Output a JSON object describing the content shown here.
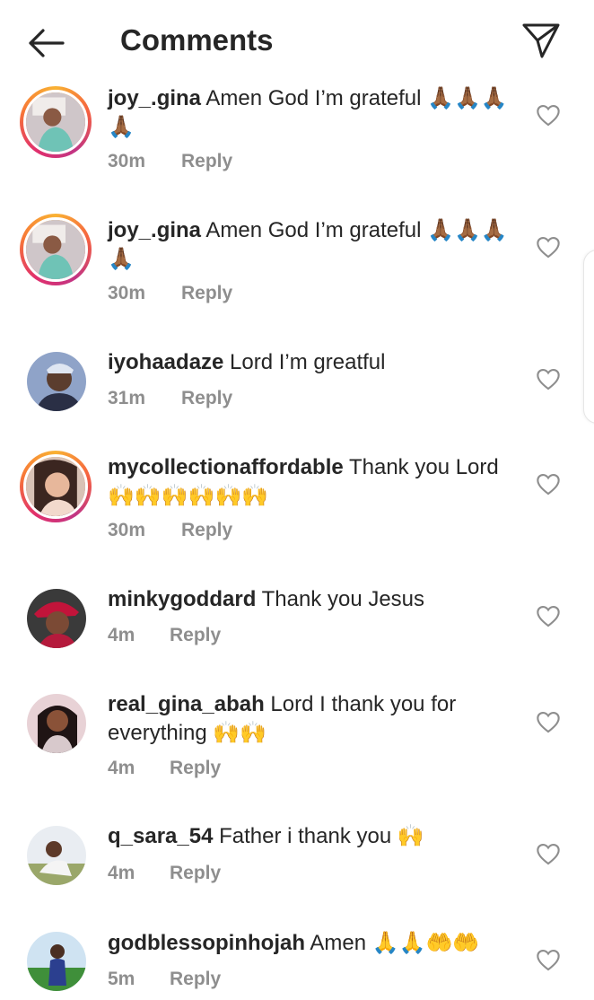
{
  "header": {
    "title": "Comments",
    "back_icon": "arrow-left-icon",
    "send_icon": "paper-plane-icon"
  },
  "reply_label": "Reply",
  "comments": [
    {
      "username": "joy_.gina",
      "text": " Amen God I’m grateful",
      "emoji": " 🙏🏾🙏🏾🙏🏾🙏🏾",
      "time": "30m",
      "avatar_style": "story"
    },
    {
      "username": "joy_.gina",
      "text": " Amen God I’m grateful",
      "emoji": " 🙏🏾🙏🏾🙏🏾🙏🏾",
      "time": "30m",
      "avatar_style": "story"
    },
    {
      "username": "iyohaadaze",
      "text": " Lord I’m greatful",
      "emoji": "",
      "time": "31m",
      "avatar_style": "plain"
    },
    {
      "username": "mycollectionaffordable",
      "text": " Thank you Lord",
      "emoji": " 🙌🙌🙌🙌🙌🙌",
      "time": "30m",
      "avatar_style": "story"
    },
    {
      "username": "minkygoddard",
      "text": " Thank you Jesus",
      "emoji": "",
      "time": "4m",
      "avatar_style": "plain"
    },
    {
      "username": "real_gina_abah",
      "text": " Lord I thank you for everything",
      "emoji": " 🙌🙌",
      "time": "4m",
      "avatar_style": "plain"
    },
    {
      "username": "q_sara_54",
      "text": " Father i thank you",
      "emoji": " 🙌",
      "time": "4m",
      "avatar_style": "plain"
    },
    {
      "username": "godblessopinhojah",
      "text": " Amen",
      "emoji": " 🙏🙏🤲🤲",
      "time": "5m",
      "avatar_style": "plain"
    }
  ],
  "colors": {
    "text": "#262626",
    "muted": "#8e8e8e",
    "background": "#ffffff"
  }
}
